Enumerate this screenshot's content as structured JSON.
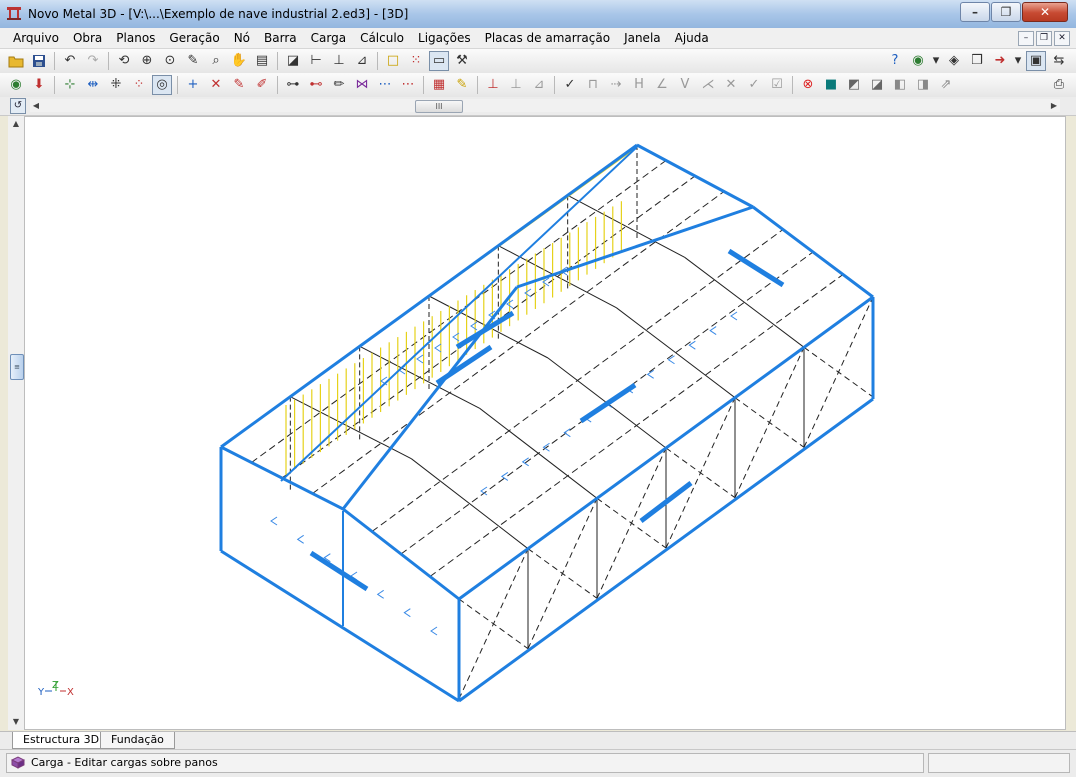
{
  "window": {
    "title": "Novo Metal 3D - [V:\\...\\Exemplo de nave industrial 2.ed3] - [3D]"
  },
  "menu": {
    "items": [
      "Arquivo",
      "Obra",
      "Planos",
      "Geração",
      "Nó",
      "Barra",
      "Carga",
      "Cálculo",
      "Ligações",
      "Placas de amarração",
      "Janela",
      "Ajuda"
    ]
  },
  "view": {
    "axis": {
      "y": "Y",
      "z": "Z",
      "x": "X"
    }
  },
  "tabs": {
    "items": [
      "Estructura 3D",
      "Fundação"
    ],
    "active": "Estructura 3D"
  },
  "status": {
    "text": "Carga - Editar cargas sobre panos"
  },
  "colors": {
    "structure_blue": "#1f7fe0",
    "wall_lines": "#222222",
    "roof_yellow": "#e6d21a",
    "status_icon": "#7a3b7a"
  }
}
